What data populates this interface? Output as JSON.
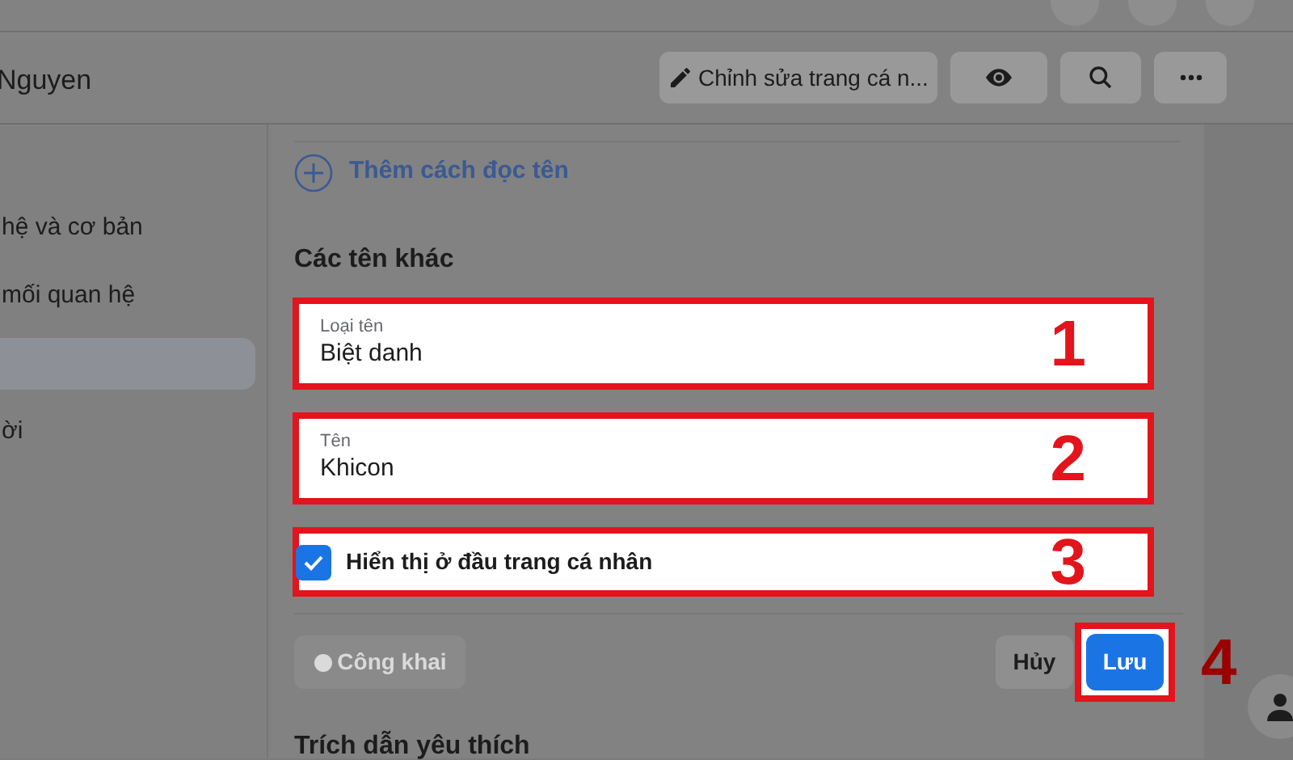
{
  "profile_header": {
    "name": "Nguyen",
    "edit_button": "Chỉnh sửa trang cá n..."
  },
  "sidebar": {
    "items": [
      {
        "label": "hệ và cơ bản",
        "selected": false
      },
      {
        "label": "mối quan hệ",
        "selected": false
      },
      {
        "selected": true
      },
      {
        "label": "ời",
        "selected": false
      }
    ]
  },
  "add_pronunciation": "Thêm cách đọc tên",
  "other_names": {
    "title": "Các tên khác",
    "fields": [
      {
        "label": "Loại tên",
        "value": "Biệt danh",
        "step": "1"
      },
      {
        "label": "Tên",
        "value": "Khicon",
        "step": "2"
      }
    ],
    "show_on_profile": {
      "label": "Hiển thị ở đầu trang cá nhân",
      "checked": true,
      "step": "3"
    },
    "audience_button": {
      "label": "Công khai",
      "disabled": true
    },
    "cancel_button": "Hủy",
    "save_button": {
      "label": "Lưu",
      "step": "4"
    }
  },
  "next_section": "Trích dẫn yêu thích"
}
